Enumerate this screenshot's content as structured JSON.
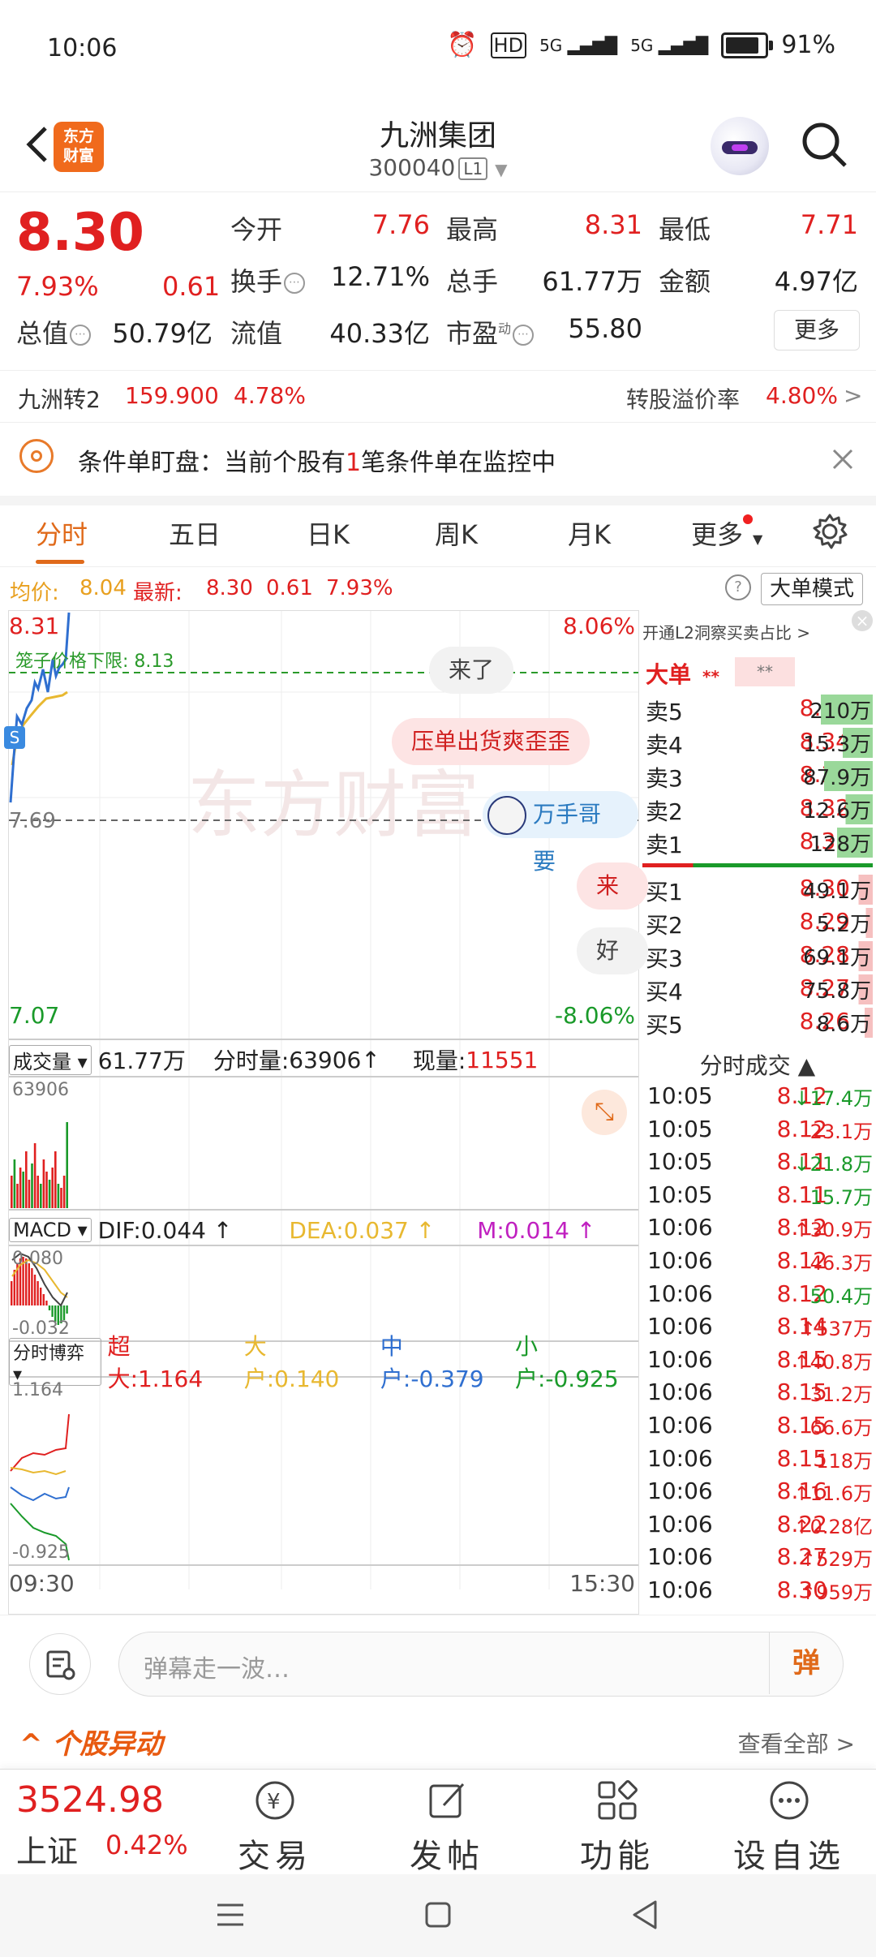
{
  "status": {
    "time": "10:06",
    "hd": "HD",
    "net1": "5G",
    "net2": "5G",
    "battery": "91%"
  },
  "header": {
    "logo_line1": "东方",
    "logo_line2": "财富",
    "title": "九洲集团",
    "code": "300040",
    "level": "L1"
  },
  "quote": {
    "price": "8.30",
    "pct": "7.93%",
    "change": "0.61",
    "open_label": "今开",
    "open": "7.76",
    "high_label": "最高",
    "high": "8.31",
    "low_label": "最低",
    "low": "7.71",
    "turnover_label": "换手",
    "turnover": "12.71%",
    "volume_label": "总手",
    "volume": "61.77万",
    "amount_label": "金额",
    "amount": "4.97亿",
    "mcap_label": "总值",
    "mcap": "50.79亿",
    "float_label": "流值",
    "float": "40.33亿",
    "pe_label": "市盈",
    "pe_sup": "动",
    "pe": "55.80",
    "more": "更多"
  },
  "bond": {
    "name": "九洲转2",
    "price": "159.900",
    "pct": "4.78%",
    "premium_label": "转股溢价率",
    "premium": "4.80%"
  },
  "condition": {
    "prefix": "条件单盯盘：当前个股有",
    "count": "1",
    "suffix": "笔条件单在监控中"
  },
  "tabs": [
    "分时",
    "五日",
    "日K",
    "周K",
    "月K",
    "更多"
  ],
  "avg": {
    "avg_label": "均价:",
    "avg": "8.04",
    "new_label": "最新:",
    "new": "8.30",
    "chg": "0.61",
    "pct": "7.93%",
    "mode": "大单模式"
  },
  "chart": {
    "y_top": "8.31",
    "y_mid": "7.69",
    "y_bot": "7.07",
    "pct_top": "8.06%",
    "pct_bot": "-8.06%",
    "limit_label": "笼子价格下限: 8.13",
    "time_start": "09:30",
    "time_end": "15:30",
    "watermark": "东方财富",
    "s_badge": "S"
  },
  "danmu": [
    "来了",
    "压单出货爽歪歪",
    "万手哥要",
    "来",
    "好"
  ],
  "volume": {
    "sel": "成交量",
    "total": "61.77万",
    "min_label": "分时量:",
    "min": "63906",
    "now_label": "现量:",
    "now": "11551",
    "ymax": "63906"
  },
  "macd": {
    "sel": "MACD",
    "dif": "DIF:0.044",
    "dea": "DEA:0.037",
    "m": "M:0.014",
    "ymax": "0.080",
    "ymin": "-0.032"
  },
  "game": {
    "sel": "分时博弈",
    "xl": "超大:1.164",
    "big": "大户:0.140",
    "mid": "中户:-0.379",
    "small": "小户:-0.925",
    "ymax": "1.164",
    "ymin": "-0.925"
  },
  "orderbook": {
    "banner": "开通L2洞察买卖占比",
    "big_label": "大单",
    "mask1": "**",
    "mask2": "**",
    "asks": [
      {
        "l": "卖5",
        "p": "8.35",
        "v": "210万"
      },
      {
        "l": "卖4",
        "p": "8.34",
        "v": "15.3万"
      },
      {
        "l": "卖3",
        "p": "8.33",
        "v": "87.9万"
      },
      {
        "l": "卖2",
        "p": "8.32",
        "v": "12.6万"
      },
      {
        "l": "卖1",
        "p": "8.31",
        "v": "128万"
      }
    ],
    "bids": [
      {
        "l": "买1",
        "p": "8.30",
        "v": "49.1万"
      },
      {
        "l": "买2",
        "p": "8.29",
        "v": "5.2万"
      },
      {
        "l": "买3",
        "p": "8.28",
        "v": "69.1万"
      },
      {
        "l": "买4",
        "p": "8.27",
        "v": "75.8万"
      },
      {
        "l": "买5",
        "p": "8.26",
        "v": "8.6万"
      }
    ],
    "trades_title": "分时成交",
    "trades": [
      {
        "t": "10:05",
        "p": "8.12",
        "a": "↓",
        "v": "17.4万",
        "d": "down"
      },
      {
        "t": "10:05",
        "p": "8.12",
        "a": "",
        "v": "23.1万",
        "d": "flat"
      },
      {
        "t": "10:05",
        "p": "8.11",
        "a": "↓",
        "v": "21.8万",
        "d": "down"
      },
      {
        "t": "10:05",
        "p": "8.11",
        "a": "",
        "v": "15.7万",
        "d": "down"
      },
      {
        "t": "10:06",
        "p": "8.12",
        "a": "↑",
        "v": "30.9万",
        "d": "up"
      },
      {
        "t": "10:06",
        "p": "8.12",
        "a": "",
        "v": "46.3万",
        "d": "flat"
      },
      {
        "t": "10:06",
        "p": "8.12",
        "a": "",
        "v": "50.4万",
        "d": "down"
      },
      {
        "t": "10:06",
        "p": "8.14",
        "a": "↑",
        "v": "537万",
        "d": "up"
      },
      {
        "t": "10:06",
        "p": "8.15",
        "a": "↑",
        "v": "40.8万",
        "d": "up"
      },
      {
        "t": "10:06",
        "p": "8.15",
        "a": "",
        "v": "31.2万",
        "d": "flat"
      },
      {
        "t": "10:06",
        "p": "8.15",
        "a": "",
        "v": "66.6万",
        "d": "flat"
      },
      {
        "t": "10:06",
        "p": "8.15",
        "a": "",
        "v": "118万",
        "d": "flat"
      },
      {
        "t": "10:06",
        "p": "8.16",
        "a": "↑",
        "v": "11.6万",
        "d": "up"
      },
      {
        "t": "10:06",
        "p": "8.22",
        "a": "↑",
        "v": "0.28亿",
        "d": "up"
      },
      {
        "t": "10:06",
        "p": "8.27",
        "a": "↑",
        "v": "529万",
        "d": "up"
      },
      {
        "t": "10:06",
        "p": "8.30",
        "a": "↑",
        "v": "959万",
        "d": "up"
      }
    ]
  },
  "input": {
    "placeholder": "弹幕走一波…",
    "dan": "弹"
  },
  "yidong": {
    "title": "个股异动",
    "all": "查看全部"
  },
  "nav": {
    "index_value": "3524.98",
    "index_name": "上证",
    "index_pct": "0.42%",
    "items": [
      "交易",
      "发帖",
      "功能",
      "设自选"
    ]
  },
  "colors": {
    "up": "#e02020",
    "down": "#1a9a2a",
    "accent": "#e06a1a",
    "price_line": "#2f6fd0",
    "avg_line": "#e8b830"
  }
}
